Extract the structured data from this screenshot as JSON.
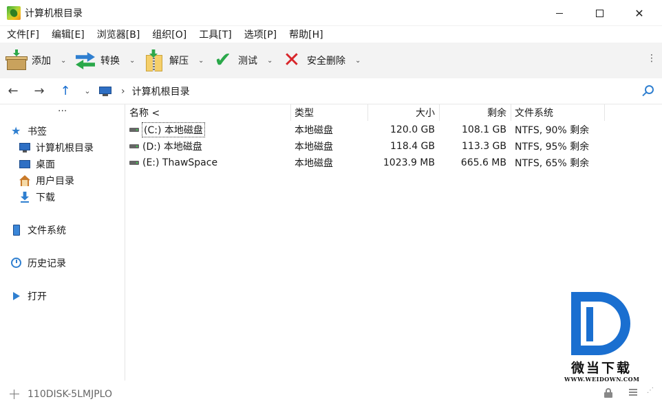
{
  "window": {
    "title": "计算机根目录",
    "minimize_label": "—",
    "close_label": "✕"
  },
  "menu": [
    "文件[F]",
    "编辑[E]",
    "浏览器[B]",
    "组织[O]",
    "工具[T]",
    "选项[P]",
    "帮助[H]"
  ],
  "toolbar": {
    "buttons": [
      {
        "label": "添加",
        "icon": "add-archive-icon"
      },
      {
        "label": "转换",
        "icon": "convert-icon"
      },
      {
        "label": "解压",
        "icon": "extract-icon"
      },
      {
        "label": "测试",
        "icon": "test-check-icon"
      },
      {
        "label": "安全删除",
        "icon": "delete-x-icon"
      }
    ],
    "caret": "⌄",
    "more": "⋮"
  },
  "address": {
    "back": "←",
    "forward": "→",
    "up": "↑",
    "dropdown": "⌄",
    "separator": "›",
    "path": "计算机根目录"
  },
  "sidebar": {
    "more": "···",
    "bookmarks": "书签",
    "items": [
      "计算机根目录",
      "桌面",
      "用户目录",
      "下载"
    ],
    "sections": [
      "文件系统",
      "历史记录",
      "打开"
    ]
  },
  "filelist": {
    "columns": [
      "名称 <",
      "类型",
      "大小",
      "剩余",
      "文件系统"
    ],
    "rows": [
      {
        "name": "(C:) 本地磁盘",
        "type": "本地磁盘",
        "size": "120.0 GB",
        "free": "108.1 GB",
        "fs": "NTFS, 90% 剩余"
      },
      {
        "name": "(D:) 本地磁盘",
        "type": "本地磁盘",
        "size": "118.4 GB",
        "free": "113.3 GB",
        "fs": "NTFS, 95% 剩余"
      },
      {
        "name": "(E:) ThawSpace",
        "type": "本地磁盘",
        "size": "1023.9 MB",
        "free": "665.6 MB",
        "fs": "NTFS, 65% 剩余"
      }
    ]
  },
  "status": {
    "computer_name": "110DISK-5LMJPLO"
  },
  "watermark": {
    "text": "微当下载",
    "url": "WWW.WEIDOWN.COM"
  },
  "colors": {
    "accent": "#1a6fd0",
    "toolbar_bg": "#f3f3f3",
    "delete_red": "#d8262b",
    "check_green": "#2aa84a"
  }
}
